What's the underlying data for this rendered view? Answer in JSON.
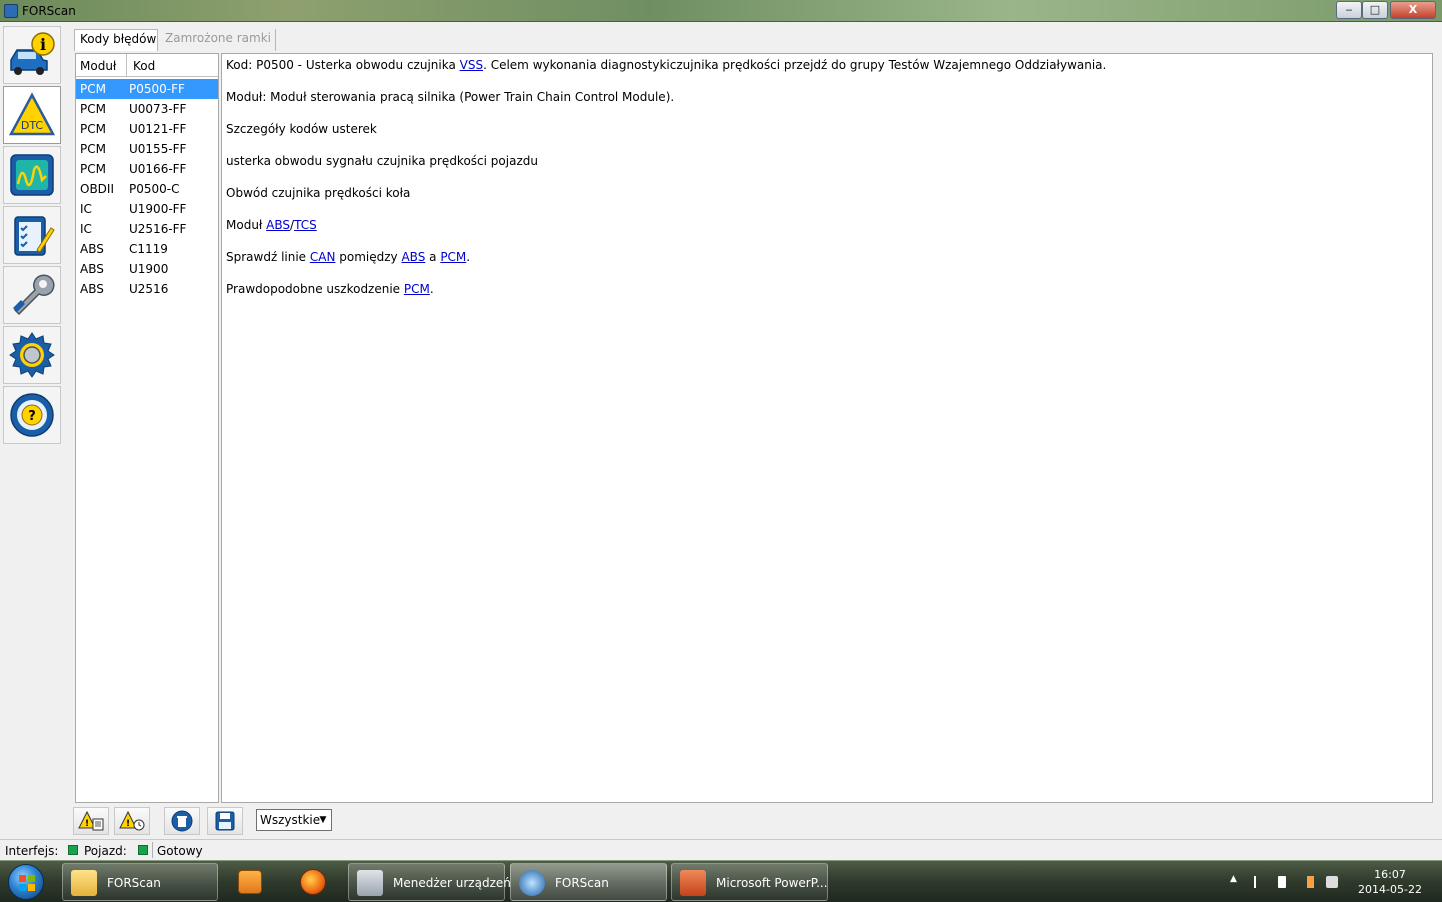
{
  "window": {
    "title": "FORScan",
    "min_label": "‒",
    "max_label": "□",
    "close_label": "X"
  },
  "sidebar": {
    "items": [
      {
        "name": "vehicle-info",
        "icon": "car-info-icon"
      },
      {
        "name": "dtc",
        "icon": "dtc-warning-icon",
        "active": true
      },
      {
        "name": "oscilloscope",
        "icon": "oscilloscope-icon"
      },
      {
        "name": "tests",
        "icon": "checklist-icon"
      },
      {
        "name": "service",
        "icon": "wrench-icon"
      },
      {
        "name": "settings",
        "icon": "gear-icon"
      },
      {
        "name": "help",
        "icon": "help-steering-icon"
      }
    ]
  },
  "tabs": [
    {
      "label": "Kody błędów",
      "active": true
    },
    {
      "label": "Zamrożone ramki",
      "active": false
    }
  ],
  "code_list": {
    "columns": [
      "Moduł",
      "Kod"
    ],
    "rows": [
      {
        "module": "PCM",
        "code": "P0500-FF",
        "selected": true
      },
      {
        "module": "PCM",
        "code": "U0073-FF"
      },
      {
        "module": "PCM",
        "code": "U0121-FF"
      },
      {
        "module": "PCM",
        "code": "U0155-FF"
      },
      {
        "module": "PCM",
        "code": "U0166-FF"
      },
      {
        "module": "OBDII",
        "code": "P0500-C"
      },
      {
        "module": "IC",
        "code": "U1900-FF"
      },
      {
        "module": "IC",
        "code": "U2516-FF"
      },
      {
        "module": "ABS",
        "code": "C1119"
      },
      {
        "module": "ABS",
        "code": "U1900"
      },
      {
        "module": "ABS",
        "code": "U2516"
      }
    ]
  },
  "details": {
    "line1": {
      "a": "Kod: P0500 - Usterka obwodu czujnika ",
      "link": "VSS",
      "b": ". Celem wykonania diagnostykiczujnika prędkości przejdź do grupy Testów Wzajemnego Oddziaływania."
    },
    "line2": "Moduł: Moduł sterowania pracą silnika (Power Train Chain Control Module).",
    "line3": "Szczegóły kodów usterek",
    "line4": "usterka obwodu sygnału czujnika prędkości pojazdu",
    "line5": "Obwód czujnika prędkości koła",
    "line6": {
      "a": "Moduł ",
      "link1": "ABS",
      "sep": "/",
      "link2": "TCS"
    },
    "line7": {
      "a": "Sprawdź linie ",
      "link1": "CAN",
      "b": " pomiędzy ",
      "link2": "ABS",
      "c": " a ",
      "link3": "PCM",
      "d": "."
    },
    "line8": {
      "a": "Prawdopodobne uszkodzenie ",
      "link": "PCM",
      "b": "."
    }
  },
  "toolbar": {
    "buttons": [
      "read-dtc-icon",
      "clear-dtc-icon",
      "delete-icon",
      "save-icon"
    ],
    "filter_value": "Wszystkie"
  },
  "status": {
    "interface_label": "Interfejs:",
    "vehicle_label": "Pojazd:",
    "state_text": "Gotowy",
    "indicator_color": "#19a34a"
  },
  "taskbar": {
    "items": [
      {
        "label": "FORScan",
        "icon": "folder-icon"
      },
      {
        "label": "",
        "icon": "media-player-icon"
      },
      {
        "label": "",
        "icon": "firefox-icon"
      },
      {
        "label": "Menedżer urządzeń",
        "icon": "device-manager-icon"
      },
      {
        "label": "FORScan",
        "icon": "forscan-app-icon"
      },
      {
        "label": "Microsoft PowerP...",
        "icon": "powerpoint-icon"
      }
    ],
    "clock_time": "16:07",
    "clock_date": "2014-05-22"
  }
}
